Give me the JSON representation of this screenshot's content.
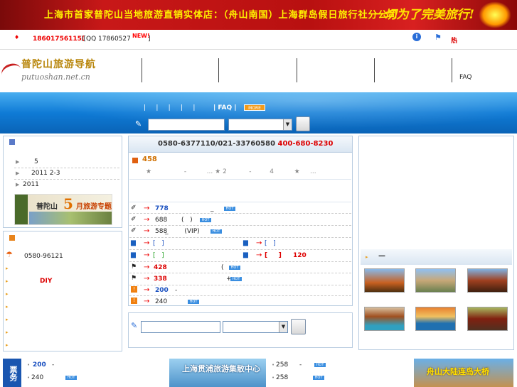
{
  "banner": {
    "headline": "上海市首家普陀山当地旅游直销实体店：（舟山南国）上海群岛假日旅行社分公司",
    "slogan": "一切为了完美旅行!"
  },
  "topbar": {
    "phone": "18601756115(",
    "qq": ")[QQ 17860527",
    "new_badge": "NEW!",
    "bracket_end": "]",
    "hot_label": "热"
  },
  "logo": {
    "cn": "普陀山旅游导航",
    "en": "putuoshan.net.cn"
  },
  "topnav": {
    "faq": "FAQ"
  },
  "bluenav": {
    "pipes": "|     |     |     |     |",
    "faq": "| FAQ |",
    "more": "MORE"
  },
  "left1": {
    "items": [
      "5",
      "2011 2-3",
      "2011"
    ]
  },
  "promo": {
    "place": "普陀山",
    "num": "5",
    "topic": "月旅游专题"
  },
  "left2": {
    "phone": "0580-96121",
    "diy": "DIY"
  },
  "center": {
    "phone_a": "0580-6377110/021-33760580 ",
    "phone_b": "400-680-8230",
    "count": "458",
    "hotline": "★                -          ... ★ 2           -         4          ★     ...",
    "rows": [
      {
        "num": "778",
        "tail": "_"
      },
      {
        "num": "688",
        "tail": "(   )"
      },
      {
        "num": "588",
        "tail": "_        (VIP)"
      },
      {
        "num": "[   ]",
        "tail": ""
      },
      {
        "num": "[   ]",
        "tail": ""
      },
      {
        "num": "428",
        "tail": "("
      },
      {
        "num": "338",
        "tail": "+"
      },
      {
        "num": "200",
        "tail": "-"
      },
      {
        "num": "240",
        "tail": ""
      }
    ],
    "right_a": "[   ]",
    "right_b": "[     ]",
    "right_b_num": "120"
  },
  "right": {
    "dash": "—"
  },
  "bottom": {
    "ticket": "票务",
    "a1": "200",
    "a1t": "-",
    "a2": "240",
    "b1": "258",
    "b1t": "-",
    "b2": "258",
    "banner1": "上海贯浦旅游集散中心",
    "banner2": "舟山大陆连岛大桥"
  },
  "hot_badge": "HOT",
  "colors": {
    "red": "#e00000",
    "blue_nav": "#0f7bd6",
    "orange": "#e8841c"
  }
}
